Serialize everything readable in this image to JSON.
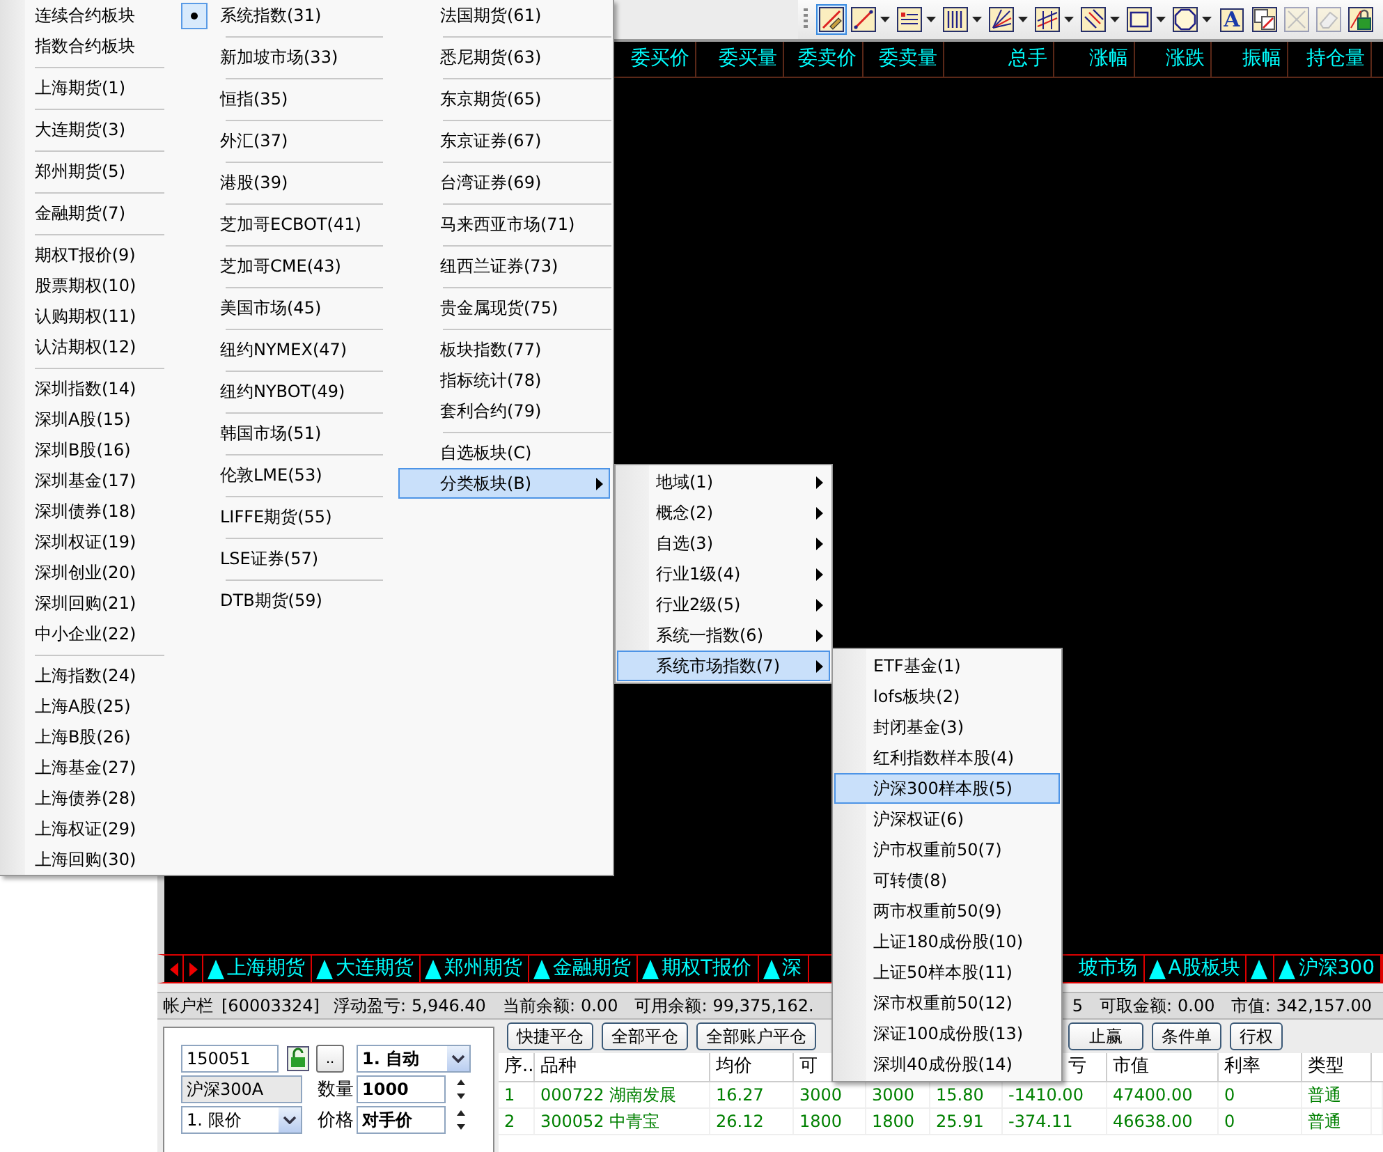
{
  "toolbar": {
    "tools": [
      {
        "kind": "icon",
        "selected": true,
        "dropdown": false,
        "disabled": false
      },
      {
        "kind": "icon",
        "selected": false,
        "dropdown": true,
        "disabled": false
      },
      {
        "kind": "icon",
        "selected": false,
        "dropdown": true,
        "disabled": false
      },
      {
        "kind": "icon",
        "selected": false,
        "dropdown": true,
        "disabled": false
      },
      {
        "kind": "icon",
        "selected": false,
        "dropdown": true,
        "disabled": false
      },
      {
        "kind": "icon",
        "selected": false,
        "dropdown": true,
        "disabled": false
      },
      {
        "kind": "icon",
        "selected": false,
        "dropdown": true,
        "disabled": false
      },
      {
        "kind": "icon",
        "selected": false,
        "dropdown": true,
        "disabled": false
      },
      {
        "kind": "icon",
        "selected": false,
        "dropdown": true,
        "disabled": false
      },
      {
        "kind": "text",
        "label": "A",
        "selected": false,
        "dropdown": false,
        "disabled": false
      },
      {
        "kind": "icon",
        "selected": false,
        "dropdown": false,
        "disabled": false
      },
      {
        "kind": "icon",
        "selected": false,
        "dropdown": false,
        "disabled": true
      },
      {
        "kind": "icon",
        "selected": false,
        "dropdown": false,
        "disabled": true
      },
      {
        "kind": "icon",
        "selected": false,
        "dropdown": false,
        "disabled": false
      }
    ]
  },
  "quote_list": {
    "columns": [
      "委买价",
      "委买量",
      "委卖价",
      "委卖量",
      "总手",
      "涨幅",
      "涨跌",
      "振幅",
      "持仓量"
    ]
  },
  "tab_bar": {
    "tabs": [
      {
        "label": "上海期货",
        "marker": true
      },
      {
        "label": "大连期货",
        "marker": true
      },
      {
        "label": "郑州期货",
        "marker": true
      },
      {
        "label": "金融期货",
        "marker": true
      },
      {
        "label": "期权T报价",
        "marker": true
      },
      {
        "label": "深",
        "marker": true
      },
      {
        "label": "坡市场",
        "marker": false
      },
      {
        "label": "A股板块",
        "marker": true
      },
      {
        "marker": true
      },
      {
        "label": "沪深300",
        "marker": true
      }
    ]
  },
  "account_bar": {
    "label": "帐户栏",
    "account": "[60003324]",
    "fields": [
      {
        "label": "浮动盈亏:",
        "value": "5,946.40"
      },
      {
        "label": "当前余额:",
        "value": "0.00"
      },
      {
        "label": "可用余额:",
        "value": "99,375,162."
      },
      {
        "value": "5"
      },
      {
        "label": "可取金额:",
        "value": "0.00"
      },
      {
        "label": "市值:",
        "value": "342,157.00"
      }
    ]
  },
  "order_form": {
    "code": "150051",
    "browse_button": "..",
    "mode": "1. 自动",
    "name": "沪深300A",
    "qty_label": "数量",
    "qty": "1000",
    "price_type": "1. 限价",
    "price_label": "价格",
    "price": "对手价"
  },
  "action_buttons": [
    "快捷平仓",
    "全部平仓",
    "全部账户平仓",
    "止赢",
    "条件单",
    "行权"
  ],
  "positions": {
    "columns": [
      {
        "label": "序.."
      },
      {
        "label": "品种"
      },
      {
        "label": "均价"
      },
      {
        "label": "可"
      },
      {},
      {},
      {
        "label": "亏"
      },
      {
        "label": "市值"
      },
      {
        "label": "利率"
      },
      {
        "label": "类型"
      }
    ],
    "rows": [
      {
        "color": "#008000",
        "cells": [
          "1",
          "000722 湖南发展",
          "16.27",
          "3000",
          "3000",
          "15.80",
          "-1410.00",
          "47400.00",
          "0",
          "普通"
        ]
      },
      {
        "color": "#008000",
        "cells": [
          "2",
          "300052 中青宝",
          "26.12",
          "1800",
          "1800",
          "25.91",
          "-374.11",
          "46638.00",
          "0",
          "普通"
        ]
      }
    ]
  },
  "market_menu": {
    "columns": [
      {
        "groups": [
          [
            {
              "label": "连续合约板块",
              "selected": false
            },
            {
              "label": "指数合约板块",
              "selected": false
            }
          ],
          [
            {
              "label": "上海期货(1)",
              "selected": false
            }
          ],
          [
            {
              "label": "大连期货(3)",
              "selected": false
            }
          ],
          [
            {
              "label": "郑州期货(5)",
              "selected": false
            }
          ],
          [
            {
              "label": "金融期货(7)",
              "selected": false
            }
          ],
          [
            {
              "label": "期权T报价(9)",
              "selected": false
            },
            {
              "label": "股票期权(10)",
              "selected": false
            },
            {
              "label": "认购期权(11)",
              "selected": false
            },
            {
              "label": "认沽期权(12)",
              "selected": false
            }
          ],
          [
            {
              "label": "深圳指数(14)",
              "selected": false
            },
            {
              "label": "深圳A股(15)",
              "selected": false
            },
            {
              "label": "深圳B股(16)",
              "selected": false
            },
            {
              "label": "深圳基金(17)",
              "selected": false
            },
            {
              "label": "深圳债券(18)",
              "selected": false
            },
            {
              "label": "深圳权证(19)",
              "selected": false
            },
            {
              "label": "深圳创业(20)",
              "selected": false
            },
            {
              "label": "深圳回购(21)",
              "selected": false
            },
            {
              "label": "中小企业(22)",
              "selected": false
            }
          ],
          [
            {
              "label": "上海指数(24)",
              "selected": false
            },
            {
              "label": "上海A股(25)",
              "selected": false
            },
            {
              "label": "上海B股(26)",
              "selected": false
            },
            {
              "label": "上海基金(27)",
              "selected": false
            },
            {
              "label": "上海债券(28)",
              "selected": false
            },
            {
              "label": "上海权证(29)",
              "selected": false
            },
            {
              "label": "上海回购(30)",
              "selected": false
            }
          ]
        ]
      },
      {
        "groups": [
          [
            {
              "label": "系统指数(31)",
              "selected": false,
              "checked": true
            }
          ],
          [
            {
              "label": "新加坡市场(33)",
              "selected": false,
              "checked": false
            }
          ],
          [
            {
              "label": "恒指(35)",
              "selected": false,
              "checked": false
            }
          ],
          [
            {
              "label": "外汇(37)",
              "selected": false,
              "checked": false
            }
          ],
          [
            {
              "label": "港股(39)",
              "selected": false,
              "checked": false
            }
          ],
          [
            {
              "label": "芝加哥ECBOT(41)",
              "selected": false,
              "checked": false
            }
          ],
          [
            {
              "label": "芝加哥CME(43)",
              "selected": false,
              "checked": false
            }
          ],
          [
            {
              "label": "美国市场(45)",
              "selected": false,
              "checked": false
            }
          ],
          [
            {
              "label": "纽约NYMEX(47)",
              "selected": false,
              "checked": false
            }
          ],
          [
            {
              "label": "纽约NYBOT(49)",
              "selected": false,
              "checked": false
            }
          ],
          [
            {
              "label": "韩国市场(51)",
              "selected": false,
              "checked": false
            }
          ],
          [
            {
              "label": "伦敦LME(53)",
              "selected": false,
              "checked": false
            }
          ],
          [
            {
              "label": "LIFFE期货(55)",
              "selected": false,
              "checked": false
            }
          ],
          [
            {
              "label": "LSE证券(57)",
              "selected": false,
              "checked": false
            }
          ],
          [
            {
              "label": "DTB期货(59)",
              "selected": false,
              "checked": false
            }
          ]
        ]
      },
      {
        "groups": [
          [
            {
              "label": "法国期货(61)",
              "selected": false,
              "submenu": false
            }
          ],
          [
            {
              "label": "悉尼期货(63)",
              "selected": false,
              "submenu": false
            }
          ],
          [
            {
              "label": "东京期货(65)",
              "selected": false,
              "submenu": false
            }
          ],
          [
            {
              "label": "东京证券(67)",
              "selected": false,
              "submenu": false
            }
          ],
          [
            {
              "label": "台湾证券(69)",
              "selected": false,
              "submenu": false
            }
          ],
          [
            {
              "label": "马来西亚市场(71)",
              "selected": false,
              "submenu": false
            }
          ],
          [
            {
              "label": "纽西兰证券(73)",
              "selected": false,
              "submenu": false
            }
          ],
          [
            {
              "label": "贵金属现货(75)",
              "selected": false,
              "submenu": false
            }
          ],
          [
            {
              "label": "板块指数(77)",
              "selected": false,
              "submenu": false
            },
            {
              "label": "指标统计(78)",
              "selected": false,
              "submenu": false
            },
            {
              "label": "套利合约(79)",
              "selected": false,
              "submenu": false
            }
          ],
          [
            {
              "label": "自选板块(C)",
              "selected": false,
              "submenu": false
            },
            {
              "label": "分类板块(B)",
              "selected": true,
              "submenu": true
            }
          ]
        ]
      }
    ]
  },
  "category_submenu": {
    "items": [
      {
        "label": "地域(1)",
        "selected": false,
        "submenu": true
      },
      {
        "label": "概念(2)",
        "selected": false,
        "submenu": true
      },
      {
        "label": "自选(3)",
        "selected": false,
        "submenu": true
      },
      {
        "label": "行业1级(4)",
        "selected": false,
        "submenu": true
      },
      {
        "label": "行业2级(5)",
        "selected": false,
        "submenu": true
      },
      {
        "label": "系统一指数(6)",
        "selected": false,
        "submenu": true
      },
      {
        "label": "系统市场指数(7)",
        "selected": true,
        "submenu": true
      }
    ]
  },
  "index_submenu": {
    "items": [
      {
        "label": "ETF基金(1)",
        "selected": false
      },
      {
        "label": "lofs板块(2)",
        "selected": false
      },
      {
        "label": "封闭基金(3)",
        "selected": false
      },
      {
        "label": "红利指数样本股(4)",
        "selected": false
      },
      {
        "label": "沪深300样本股(5)",
        "selected": true
      },
      {
        "label": "沪深权证(6)",
        "selected": false
      },
      {
        "label": "沪市权重前50(7)",
        "selected": false
      },
      {
        "label": "可转债(8)",
        "selected": false
      },
      {
        "label": "两市权重前50(9)",
        "selected": false
      },
      {
        "label": "上证180成份股(10)",
        "selected": false
      },
      {
        "label": "上证50样本股(11)",
        "selected": false
      },
      {
        "label": "深市权重前50(12)",
        "selected": false
      },
      {
        "label": "深证100成份股(13)",
        "selected": false
      },
      {
        "label": "深圳40成份股(14)",
        "selected": false
      }
    ]
  }
}
